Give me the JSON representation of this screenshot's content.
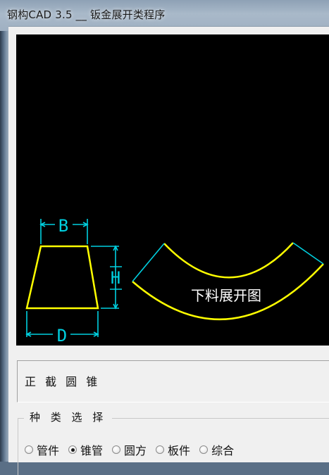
{
  "window": {
    "title": "钢构CAD 3.5 __ 钣金展开类程序"
  },
  "drawing": {
    "dimension_top": "B",
    "dimension_bottom": "D",
    "dimension_side": "H",
    "unfold_label": "下料展开图",
    "colors": {
      "background": "#000000",
      "shape": "#ffff00",
      "dimension": "#00d0e0",
      "label": "#ffffff"
    }
  },
  "info": {
    "shape_name": "正 截 圆 锥"
  },
  "category": {
    "legend": "种 类 选 择",
    "options": [
      "管件",
      "锥管",
      "圆方",
      "板件",
      "综合"
    ],
    "selected": "锥管"
  }
}
